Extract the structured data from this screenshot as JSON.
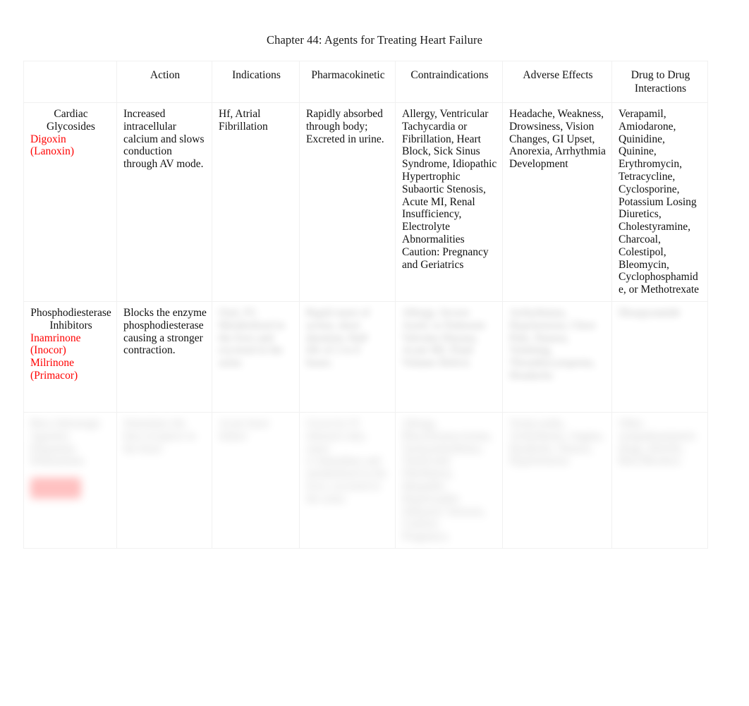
{
  "document": {
    "title": "Chapter 44: Agents for Treating Heart Failure"
  },
  "table": {
    "columns": [
      {
        "id": "drug_class",
        "label": ""
      },
      {
        "id": "action",
        "label": "Action"
      },
      {
        "id": "indications",
        "label": "Indications"
      },
      {
        "id": "pharmacokinetic",
        "label": "Pharmacokinetic"
      },
      {
        "id": "contraindications",
        "label": "Contraindications"
      },
      {
        "id": "adverse_effects",
        "label": "Adverse Effects"
      },
      {
        "id": "drug_to_drug",
        "label": "Drug to Drug Interactions"
      }
    ],
    "rows": [
      {
        "legible": true,
        "class_name": "Cardiac Glycosides",
        "drugs": [
          "Digoxin (Lanoxin)"
        ],
        "action": "Increased intracellular calcium and slows conduction through AV mode.",
        "indications": "Hf, Atrial Fibrillation",
        "pharmacokinetic": "Rapidly absorbed through body; Excreted in urine.",
        "contraindications": "Allergy, Ventricular Tachycardia or Fibrillation, Heart Block, Sick Sinus Syndrome, Idiopathic Hypertrophic Subaortic Stenosis, Acute MI, Renal Insufficiency, Electrolyte Abnormalities Caution: Pregnancy and Geriatrics",
        "adverse_effects": "Headache, Weakness, Drowsiness, Vision Changes, GI Upset, Anorexia, Arrhythmia Development",
        "drug_to_drug": "Verapamil, Amiodarone, Quinidine, Quinine, Erythromycin, Tetracycline, Cyclosporine, Potassium Losing Diuretics, Cholestyramine, Charcoal, Colestipol, Bleomycin, Cyclophosphamide, or Methotrexate"
      },
      {
        "legible": false,
        "class_name": "Phosphodiesterase Inhibitors",
        "drugs": [
          "Inamrinone (Inocor)",
          "Milrinone (Primacor)"
        ],
        "action": "Blocks the enzyme phosphodiesterase causing a stronger contraction.",
        "indications": "",
        "pharmacokinetic": "",
        "contraindications": "",
        "adverse_effects": "",
        "drug_to_drug": ""
      },
      {
        "legible": false,
        "class_name": "",
        "drugs": [],
        "action": "",
        "indications": "",
        "pharmacokinetic": "",
        "contraindications": "",
        "adverse_effects": "",
        "drug_to_drug": ""
      }
    ]
  }
}
